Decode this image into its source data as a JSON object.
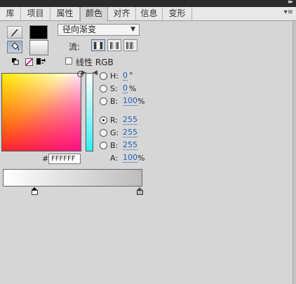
{
  "tabs": [
    {
      "label": "库"
    },
    {
      "label": "项目"
    },
    {
      "label": "属性"
    },
    {
      "label": "颜色",
      "active": true
    },
    {
      "label": "对齐"
    },
    {
      "label": "信息"
    },
    {
      "label": "变形"
    }
  ],
  "tab_menu_icon": "panel-menu-icon",
  "collapse_icon": "collapse-arrows-icon",
  "stroke_swatch_color": "#000000",
  "fill_swatch_color": "#ffffff",
  "fill_type": {
    "selected": "径向渐变"
  },
  "flow": {
    "label": "流:",
    "modes": [
      "extend",
      "reflect",
      "repeat"
    ],
    "selected": "extend"
  },
  "linear_rgb": {
    "label": "线性 RGB",
    "checked": false
  },
  "hsb": {
    "h": {
      "label": "H:",
      "value": "0",
      "unit": "°"
    },
    "s": {
      "label": "S:",
      "value": "0",
      "unit": "%"
    },
    "b": {
      "label": "B:",
      "value": "100",
      "unit": "%"
    }
  },
  "rgb": {
    "r": {
      "label": "R:",
      "value": "255",
      "selected": true
    },
    "g": {
      "label": "G:",
      "value": "255"
    },
    "b": {
      "label": "B:",
      "value": "255"
    }
  },
  "alpha": {
    "label": "A:",
    "value": "100",
    "unit": "%"
  },
  "hex": {
    "prefix": "#",
    "value": "FFFFFF"
  },
  "gradient_stops": [
    {
      "color": "#ffffff",
      "position": 0.0,
      "selected": true
    },
    {
      "color": "#bdbdbd",
      "position": 1.0,
      "selected": false
    }
  ]
}
